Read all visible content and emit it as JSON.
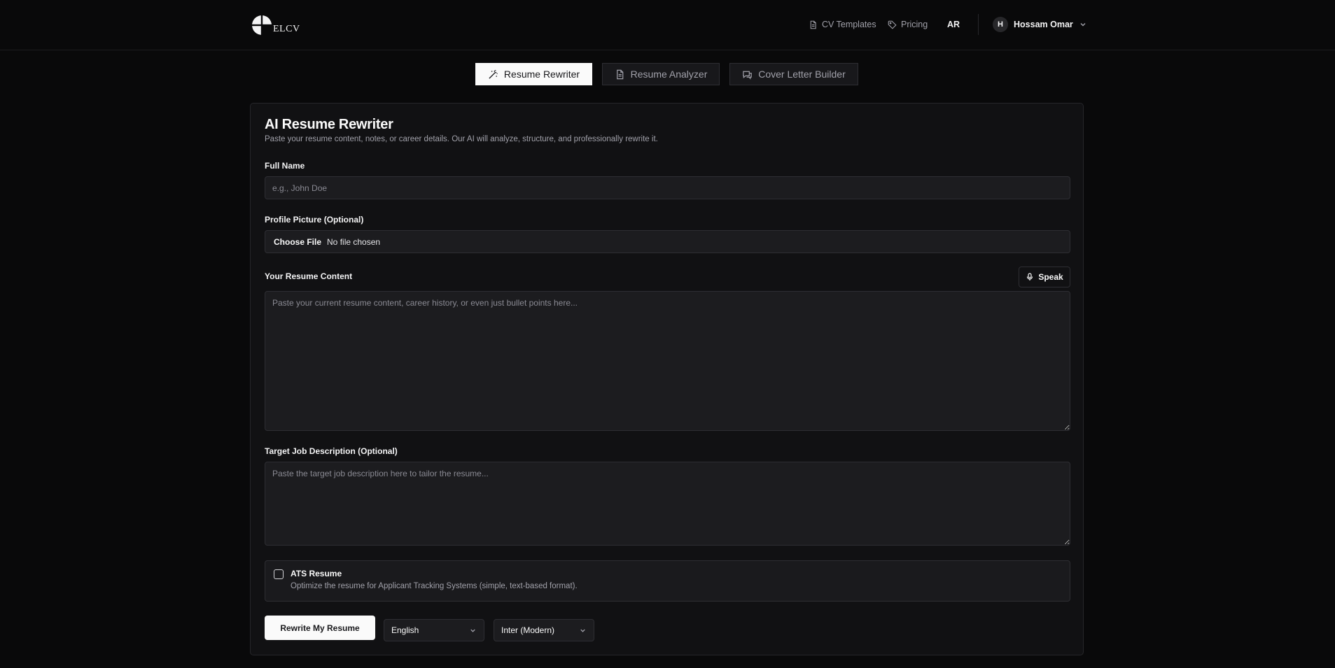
{
  "header": {
    "logo_text": "ELCV",
    "nav": {
      "cv_templates": "CV Templates",
      "pricing": "Pricing",
      "language": "AR"
    },
    "user": {
      "initial": "H",
      "name": "Hossam Omar"
    }
  },
  "tabs": [
    {
      "label": "Resume Rewriter",
      "icon": "wand-icon",
      "active": true
    },
    {
      "label": "Resume Analyzer",
      "icon": "document-icon",
      "active": false
    },
    {
      "label": "Cover Letter Builder",
      "icon": "chat-icon",
      "active": false
    }
  ],
  "form": {
    "title": "AI Resume Rewriter",
    "subtitle": "Paste your resume content, notes, or career details. Our AI will analyze, structure, and professionally rewrite it.",
    "full_name": {
      "label": "Full Name",
      "placeholder": "e.g., John Doe",
      "value": ""
    },
    "profile_picture": {
      "label": "Profile Picture (Optional)",
      "button": "Choose File",
      "status": "No file chosen"
    },
    "resume_content": {
      "label": "Your Resume Content",
      "speak_label": "Speak",
      "placeholder": "Paste your current resume content, career history, or even just bullet points here...",
      "value": ""
    },
    "job_description": {
      "label": "Target Job Description (Optional)",
      "placeholder": "Paste the target job description here to tailor the resume...",
      "value": ""
    },
    "ats": {
      "checked": false,
      "title": "ATS Resume",
      "description": "Optimize the resume for Applicant Tracking Systems (simple, text-based format)."
    },
    "submit_label": "Rewrite My Resume",
    "language_select": "English",
    "font_select": "Inter (Modern)"
  },
  "colors": {
    "background": "#09090a",
    "card": "#111113",
    "field": "#1c1c1f",
    "border": "#2e2e33",
    "primary": "#fafafa",
    "muted_text": "#a1a1aa"
  }
}
